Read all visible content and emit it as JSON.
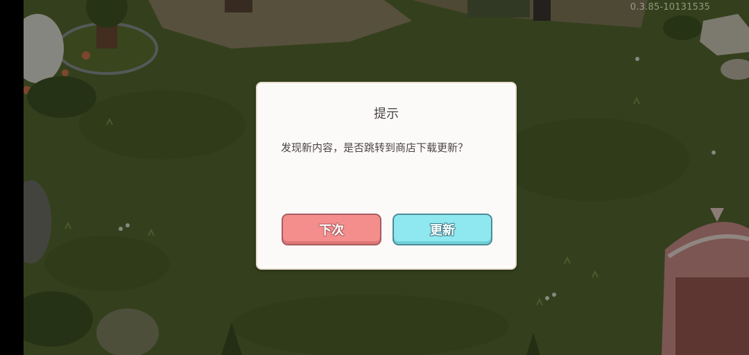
{
  "hud": {
    "version_text": "0.3.85-10131535"
  },
  "dialog": {
    "title": "提示",
    "message": "发现新内容，是否跳转到商店下载更新？",
    "later_label": "下次",
    "update_label": "更新"
  },
  "colors": {
    "grass": "#4a5a2a",
    "dialog_bg": "#fcfaf8",
    "later_button": "#f48e8d",
    "update_button": "#8fe8ef"
  }
}
